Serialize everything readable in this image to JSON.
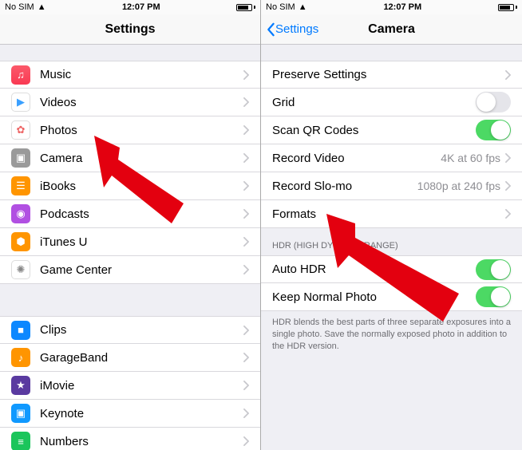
{
  "status": {
    "carrier": "No SIM",
    "wifi": "▾",
    "time": "12:07 PM"
  },
  "left": {
    "title": "Settings",
    "items": [
      {
        "name": "music",
        "label": "Music",
        "glyph": "♫",
        "cls": "ic-music"
      },
      {
        "name": "videos",
        "label": "Videos",
        "glyph": "▶",
        "cls": "ic-videos",
        "glyphColor": "#3aa0ff"
      },
      {
        "name": "photos",
        "label": "Photos",
        "glyph": "✿",
        "cls": "ic-photos",
        "glyphColor": "#e66"
      },
      {
        "name": "camera",
        "label": "Camera",
        "glyph": "▣",
        "cls": "ic-camera"
      },
      {
        "name": "ibooks",
        "label": "iBooks",
        "glyph": "☰",
        "cls": "ic-ibooks"
      },
      {
        "name": "podcasts",
        "label": "Podcasts",
        "glyph": "◉",
        "cls": "ic-podcasts"
      },
      {
        "name": "itunesu",
        "label": "iTunes U",
        "glyph": "⬢",
        "cls": "ic-itunesu"
      },
      {
        "name": "gamecenter",
        "label": "Game Center",
        "glyph": "✺",
        "cls": "ic-gamecenter",
        "glyphColor": "#888"
      }
    ],
    "items2": [
      {
        "name": "clips",
        "label": "Clips",
        "glyph": "■",
        "cls": "ic-clips"
      },
      {
        "name": "garageband",
        "label": "GarageBand",
        "glyph": "♪",
        "cls": "ic-garage"
      },
      {
        "name": "imovie",
        "label": "iMovie",
        "glyph": "★",
        "cls": "ic-imovie"
      },
      {
        "name": "keynote",
        "label": "Keynote",
        "glyph": "▣",
        "cls": "ic-keynote"
      },
      {
        "name": "numbers",
        "label": "Numbers",
        "glyph": "≡",
        "cls": "ic-numbers"
      }
    ]
  },
  "right": {
    "backLabel": "Settings",
    "title": "Camera",
    "rows": [
      {
        "name": "preserve-settings",
        "label": "Preserve Settings",
        "accessory": "disclosure"
      },
      {
        "name": "grid",
        "label": "Grid",
        "accessory": "switch",
        "on": false
      },
      {
        "name": "scan-qr",
        "label": "Scan QR Codes",
        "accessory": "switch",
        "on": true
      },
      {
        "name": "record-video",
        "label": "Record Video",
        "detail": "4K at 60 fps",
        "accessory": "disclosure"
      },
      {
        "name": "record-slomo",
        "label": "Record Slo-mo",
        "detail": "1080p at 240 fps",
        "accessory": "disclosure"
      },
      {
        "name": "formats",
        "label": "Formats",
        "accessory": "disclosure"
      }
    ],
    "hdrHeader": "HDR (HIGH DYNAMIC RANGE)",
    "hdrRows": [
      {
        "name": "auto-hdr",
        "label": "Auto HDR",
        "accessory": "switch",
        "on": true
      },
      {
        "name": "keep-normal",
        "label": "Keep Normal Photo",
        "accessory": "switch",
        "on": true
      }
    ],
    "hdrFooter": "HDR blends the best parts of three separate exposures into a single photo. Save the normally exposed photo in addition to the HDR version."
  }
}
